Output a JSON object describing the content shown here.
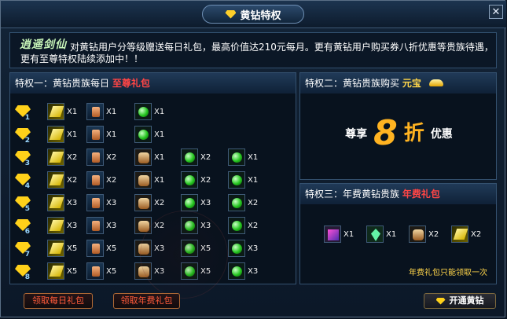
{
  "window": {
    "title": "黄钻特权",
    "close_icon": "close-icon"
  },
  "intro": {
    "logo_text": "逍遥剑仙",
    "description": "对黄钻用户分等级赠送每日礼包，最高价值达210元每月。更有黄钻用户购买券八折优惠等贵族待遇，更有至尊特权陆续添加中！！"
  },
  "privilege1": {
    "label": "特权一：黄钻贵族每日",
    "highlight": "至尊礼包",
    "rows": [
      {
        "level": "1",
        "items": [
          {
            "icon": "scroll-icon",
            "qty": "X1"
          },
          {
            "icon": "potion-icon",
            "qty": "X1"
          },
          {
            "icon": "green-orb-icon",
            "qty": "X1"
          }
        ]
      },
      {
        "level": "2",
        "items": [
          {
            "icon": "scroll-icon",
            "qty": "X1"
          },
          {
            "icon": "potion-icon",
            "qty": "X1"
          },
          {
            "icon": "green-orb-icon",
            "qty": "X1"
          }
        ]
      },
      {
        "level": "3",
        "items": [
          {
            "icon": "scroll-icon",
            "qty": "X2"
          },
          {
            "icon": "potion-icon",
            "qty": "X2"
          },
          {
            "icon": "bag-icon",
            "qty": "X1"
          },
          {
            "icon": "green-orb-icon",
            "qty": "X2"
          },
          {
            "icon": "green-orb-icon",
            "qty": "X1"
          }
        ]
      },
      {
        "level": "4",
        "items": [
          {
            "icon": "scroll-icon",
            "qty": "X2"
          },
          {
            "icon": "potion-icon",
            "qty": "X2"
          },
          {
            "icon": "bag-icon",
            "qty": "X1"
          },
          {
            "icon": "green-orb-icon",
            "qty": "X2"
          },
          {
            "icon": "green-orb-icon",
            "qty": "X1"
          }
        ]
      },
      {
        "level": "5",
        "items": [
          {
            "icon": "scroll-icon",
            "qty": "X3"
          },
          {
            "icon": "potion-icon",
            "qty": "X3"
          },
          {
            "icon": "bag-icon",
            "qty": "X2"
          },
          {
            "icon": "green-orb-icon",
            "qty": "X3"
          },
          {
            "icon": "green-orb-icon",
            "qty": "X2"
          }
        ]
      },
      {
        "level": "6",
        "items": [
          {
            "icon": "scroll-icon",
            "qty": "X3"
          },
          {
            "icon": "potion-icon",
            "qty": "X3"
          },
          {
            "icon": "bag-icon",
            "qty": "X2"
          },
          {
            "icon": "green-orb-icon",
            "qty": "X3"
          },
          {
            "icon": "green-orb-icon",
            "qty": "X2"
          }
        ]
      },
      {
        "level": "7",
        "items": [
          {
            "icon": "scroll-icon",
            "qty": "X5"
          },
          {
            "icon": "potion-icon",
            "qty": "X5"
          },
          {
            "icon": "bag-icon",
            "qty": "X3"
          },
          {
            "icon": "green-orb-icon",
            "qty": "X5"
          },
          {
            "icon": "green-orb-icon",
            "qty": "X3"
          }
        ]
      },
      {
        "level": "8",
        "items": [
          {
            "icon": "scroll-icon",
            "qty": "X5"
          },
          {
            "icon": "potion-icon",
            "qty": "X5"
          },
          {
            "icon": "bag-icon",
            "qty": "X3"
          },
          {
            "icon": "green-orb-icon",
            "qty": "X5"
          },
          {
            "icon": "green-orb-icon",
            "qty": "X3"
          }
        ]
      }
    ]
  },
  "privilege2": {
    "label": "特权二：黄钻贵族购买",
    "highlight": "元宝",
    "discount_prefix": "尊享",
    "discount_number": "8",
    "discount_unit": "折",
    "discount_suffix": "优惠"
  },
  "privilege3": {
    "label": "特权三：年费黄钻贵族",
    "highlight": "年费礼包",
    "items": [
      {
        "icon": "gift-box-icon",
        "qty": "X1"
      },
      {
        "icon": "leaf-icon",
        "qty": "X1"
      },
      {
        "icon": "bag-icon",
        "qty": "X2"
      },
      {
        "icon": "scroll-icon",
        "qty": "X2"
      }
    ],
    "note": "年费礼包只能领取一次"
  },
  "buttons": {
    "daily": "领取每日礼包",
    "annual": "领取年费礼包",
    "open": "开通黄钻"
  },
  "colors": {
    "accent_gold": "#ffd11a",
    "alert_red": "#ff4545",
    "discount_orange": "#ffb321"
  }
}
